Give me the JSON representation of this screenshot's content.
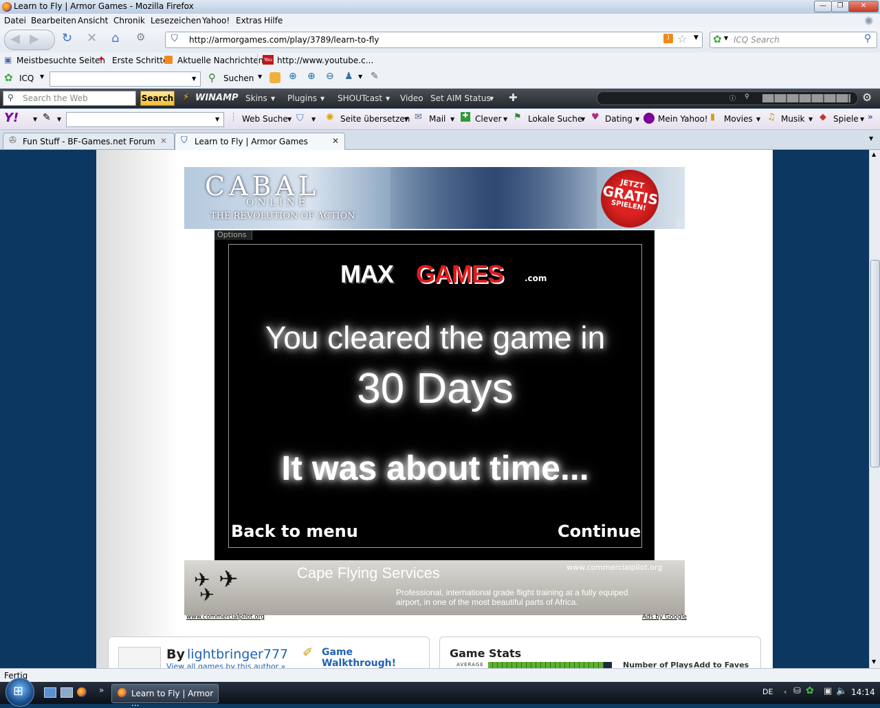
{
  "window": {
    "title": "Learn to Fly | Armor Games - Mozilla Firefox"
  },
  "menu": [
    "Datei",
    "Bearbeiten",
    "Ansicht",
    "Chronik",
    "Lesezeichen",
    "Yahoo!",
    "Extras",
    "Hilfe"
  ],
  "nav": {
    "url": "http://armorgames.com/play/3789/learn-to-fly",
    "search_placeholder": "ICQ Search"
  },
  "bookmarks": [
    "Meistbesuchte Seiten",
    "Erste Schritte",
    "Aktuelle Nachrichten",
    "http://www.youtube.c..."
  ],
  "icqbar": {
    "label": "ICQ",
    "search_label": "Suchen"
  },
  "winampbar": {
    "search_placeholder": "Search the Web",
    "search_button": "Search",
    "logo": "WINAMP",
    "items": [
      "Skins",
      "Plugins",
      "SHOUTcast",
      "Video",
      "Set AIM Status"
    ]
  },
  "yahoobar": {
    "items": [
      "Web Suche",
      "Seite übersetzen",
      "Mail",
      "Clever",
      "Lokale Suche",
      "Dating",
      "Mein Yahoo!",
      "Movies",
      "Musik",
      "Spiele"
    ]
  },
  "tabs": [
    {
      "label": "Fun Stuff - BF-Games.net Forum"
    },
    {
      "label": "Learn to Fly | Armor Games"
    }
  ],
  "cabal_ad": {
    "title": "CABAL",
    "subtitle": "ONLINE",
    "tagline": "THE REVOLUTION OF ACTION",
    "badge_line1": "JETZT",
    "badge_line2": "GRATIS",
    "badge_line3": "SPIELEN!"
  },
  "game": {
    "options_label": "Options",
    "logo_left": "MAX",
    "logo_right": "GAMES",
    "logo_suffix": ".com",
    "line1": "You cleared the game in",
    "line2": "30 Days",
    "line3": "It was about time...",
    "back_button": "Back to menu",
    "continue_button": "Continue"
  },
  "cape_ad": {
    "title": "Cape Flying Services",
    "url": "www.commercialpilot.org",
    "text1": "Professional, international grade flight training at a fully equiped",
    "text2": "airport, in one of the most beautiful parts of Africa.",
    "footer_url": "www.commercialpilot.org",
    "ads_by": "Ads by Google"
  },
  "author": {
    "by": "By",
    "name": "lightbringer777",
    "view_all": "View all games by this author »",
    "walkthrough": "Game Walkthrough!"
  },
  "stats": {
    "title": "Game Stats",
    "average_label": "AVERAGE",
    "plays_label": "Number of Plays",
    "faves_label": "Add to Faves"
  },
  "status": {
    "text": "Fertig"
  },
  "taskbar": {
    "task_label": "Learn to Fly | Armor ...",
    "lang": "DE",
    "clock": "14:14"
  },
  "colors": {
    "link_blue": "#1f62b5",
    "winamp_bg": "#2f3238",
    "page_bg": "#0b3760"
  }
}
